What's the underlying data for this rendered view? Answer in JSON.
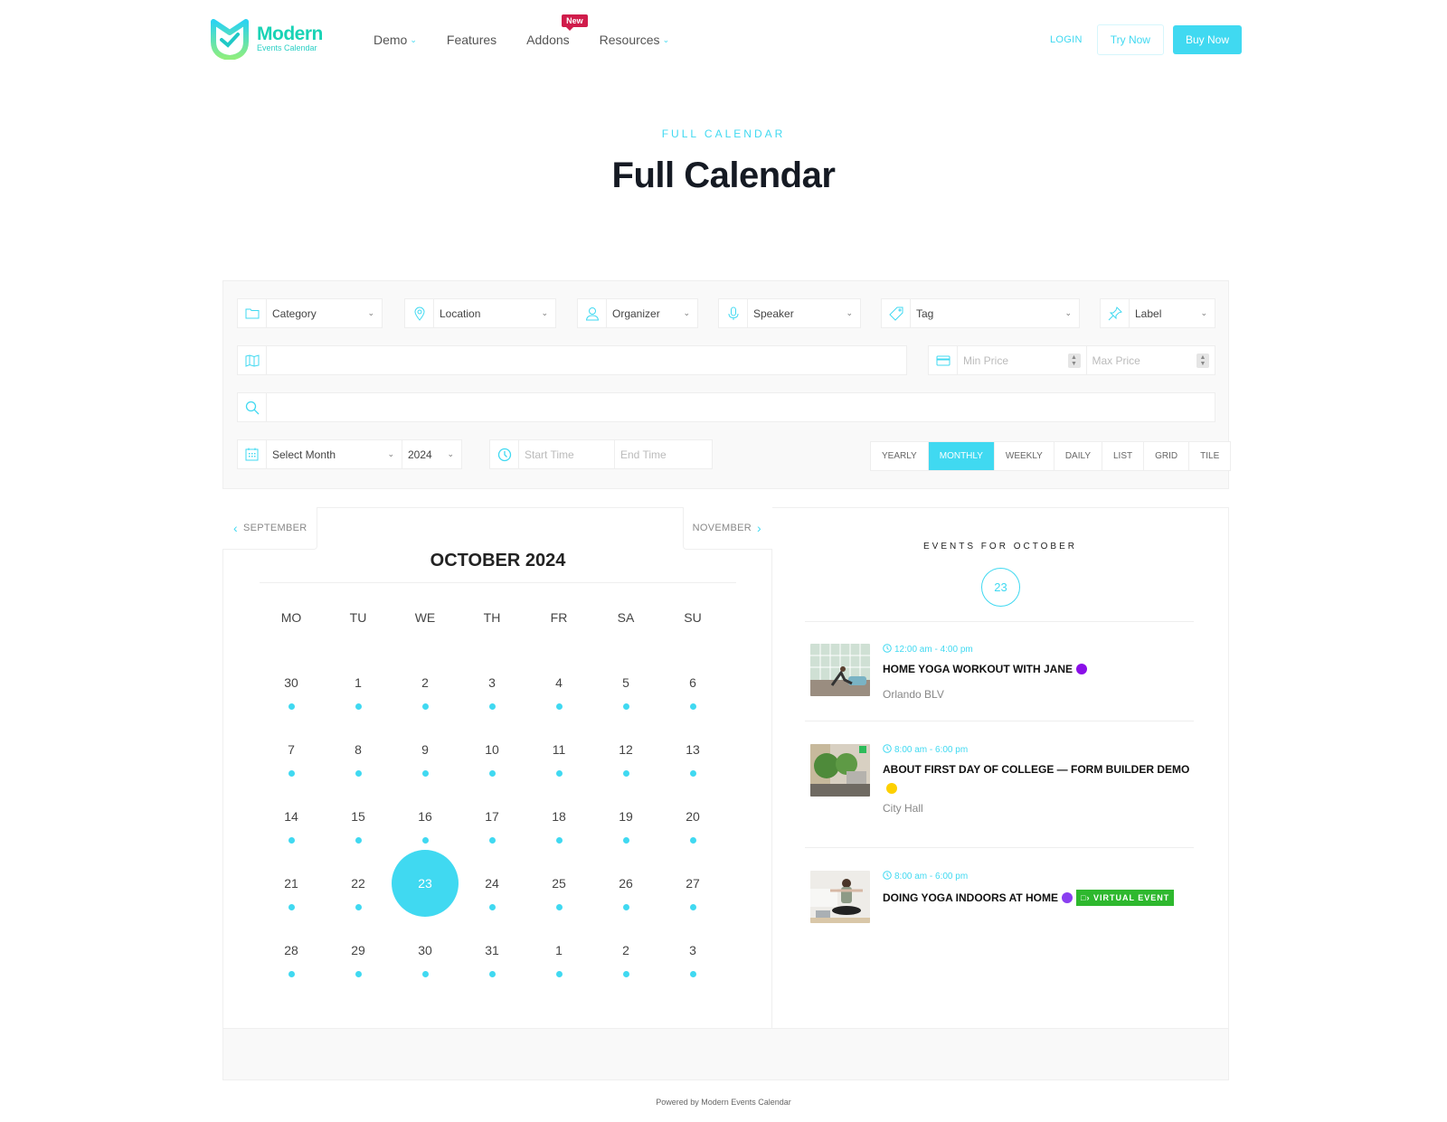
{
  "brand": {
    "name": "Modern",
    "sub": "Events Calendar",
    "accent": "#40d9f1"
  },
  "nav": [
    {
      "label": "Demo",
      "dropdown": true
    },
    {
      "label": "Features",
      "dropdown": false
    },
    {
      "label": "Addons",
      "dropdown": false,
      "badge": "New"
    },
    {
      "label": "Resources",
      "dropdown": true
    }
  ],
  "header_actions": {
    "login": "LOGIN",
    "try": "Try Now",
    "buy": "Buy Now"
  },
  "hero": {
    "eyebrow": "FULL CALENDAR",
    "title": "Full Calendar"
  },
  "filters": {
    "category": "Category",
    "location": "Location",
    "organizer": "Organizer",
    "speaker": "Speaker",
    "tag": "Tag",
    "label": "Label",
    "address_value": "",
    "min_price_placeholder": "Min Price",
    "max_price_placeholder": "Max Price",
    "search_value": "",
    "month": "Select Month",
    "year": "2024",
    "start_time_placeholder": "Start Time",
    "end_time_placeholder": "End Time"
  },
  "views": [
    {
      "label": "YEARLY",
      "active": false
    },
    {
      "label": "MONTHLY",
      "active": true
    },
    {
      "label": "WEEKLY",
      "active": false
    },
    {
      "label": "DAILY",
      "active": false
    },
    {
      "label": "LIST",
      "active": false
    },
    {
      "label": "GRID",
      "active": false
    },
    {
      "label": "TILE",
      "active": false
    }
  ],
  "calendar": {
    "prev": "SEPTEMBER",
    "next": "NOVEMBER",
    "title": "OCTOBER 2024",
    "weekdays": [
      "MO",
      "TU",
      "WE",
      "TH",
      "FR",
      "SA",
      "SU"
    ],
    "weeks": [
      [
        "30",
        "1",
        "2",
        "3",
        "4",
        "5",
        "6"
      ],
      [
        "7",
        "8",
        "9",
        "10",
        "11",
        "12",
        "13"
      ],
      [
        "14",
        "15",
        "16",
        "17",
        "18",
        "19",
        "20"
      ],
      [
        "21",
        "22",
        "23",
        "24",
        "25",
        "26",
        "27"
      ],
      [
        "28",
        "29",
        "30",
        "31",
        "1",
        "2",
        "3"
      ]
    ],
    "selected": "23"
  },
  "events_panel": {
    "heading": "EVENTS FOR OCTOBER",
    "day": "23",
    "events": [
      {
        "time": "12:00 am - 4:00 pm",
        "title": "HOME YOGA WORKOUT WITH JANE",
        "color": "#8a0fe8",
        "location": "Orlando BLV",
        "virtual": ""
      },
      {
        "time": "8:00 am - 6:00 pm",
        "title": "ABOUT FIRST DAY OF COLLEGE — FORM BUILDER DEMO",
        "color": "#fdd000",
        "location": "City Hall",
        "virtual": ""
      },
      {
        "time": "8:00 am - 6:00 pm",
        "title": "DOING YOGA INDOORS AT HOME",
        "color": "#8a3ff0",
        "location": "",
        "virtual": "VIRTUAL EVENT"
      }
    ]
  },
  "footer": {
    "powered": "Powered by Modern Events Calendar"
  }
}
